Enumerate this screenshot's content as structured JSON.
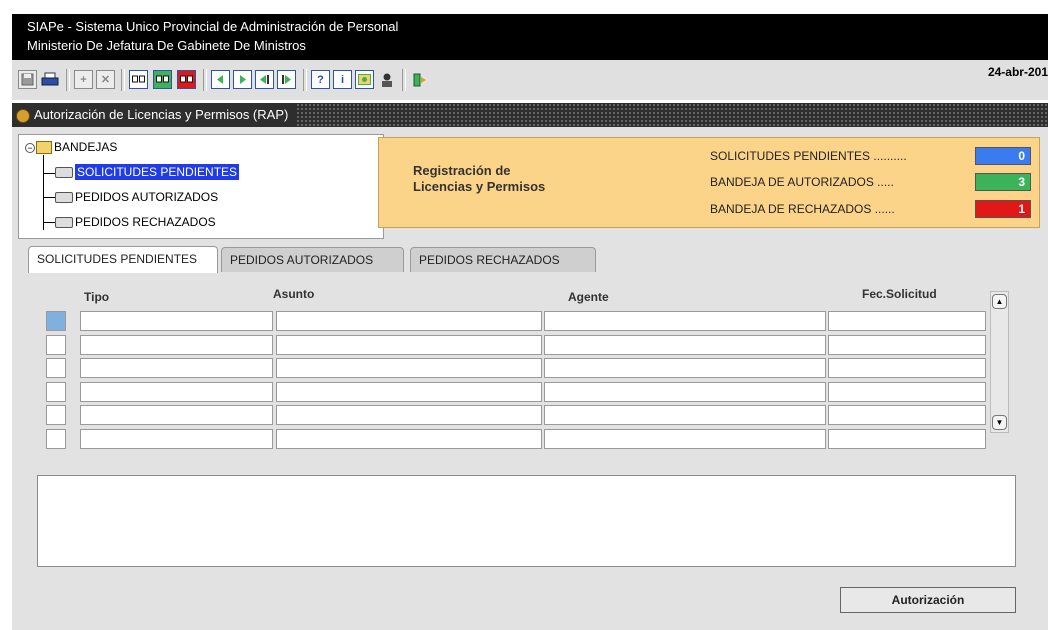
{
  "window": {
    "title_line1": "SIAPe - Sistema Unico Provincial de Administración de Personal",
    "title_line2": "Ministerio De Jefatura De Gabinete De Ministros"
  },
  "toolbar": {
    "date": "24-abr-201",
    "buttons": [
      {
        "name": "save-icon",
        "glyph": ""
      },
      {
        "name": "print-icon",
        "glyph": ""
      },
      {
        "name": "add-record-icon",
        "glyph": "+"
      },
      {
        "name": "delete-record-icon",
        "glyph": "✕"
      },
      {
        "name": "query-blue-icon",
        "glyph": ""
      },
      {
        "name": "query-green-icon",
        "glyph": ""
      },
      {
        "name": "query-red-icon",
        "glyph": ""
      },
      {
        "name": "first-record-icon",
        "glyph": "◀"
      },
      {
        "name": "next-record-icon",
        "glyph": "▶"
      },
      {
        "name": "prev-block-icon",
        "glyph": "◀"
      },
      {
        "name": "next-block-icon",
        "glyph": "▶"
      },
      {
        "name": "help-icon",
        "glyph": "?"
      },
      {
        "name": "info-icon",
        "glyph": "i"
      },
      {
        "name": "calendar-icon",
        "glyph": ""
      },
      {
        "name": "user-icon",
        "glyph": ""
      },
      {
        "name": "exit-icon",
        "glyph": ""
      }
    ]
  },
  "panel": {
    "title": "Autorización de Licencias y Permisos (RAP)"
  },
  "tree": {
    "root": "BANDEJAS",
    "items": [
      {
        "label": "SOLICITUDES PENDIENTES"
      },
      {
        "label": "PEDIDOS AUTORIZADOS"
      },
      {
        "label": "PEDIDOS RECHAZADOS"
      }
    ]
  },
  "summary": {
    "heading_line1": "Registración de",
    "heading_line2": "Licencias y Permisos",
    "rows": [
      {
        "label": "SOLICITUDES PENDIENTES ..........",
        "count": "0",
        "color": "#3a7cf0"
      },
      {
        "label": "BANDEJA DE AUTORIZADOS .....",
        "count": "3",
        "color": "#3cb35a"
      },
      {
        "label": "BANDEJA DE RECHAZADOS ......",
        "count": "1",
        "color": "#e01818"
      }
    ]
  },
  "tabs": [
    {
      "label": "SOLICITUDES PENDIENTES"
    },
    {
      "label": "PEDIDOS AUTORIZADOS"
    },
    {
      "label": "PEDIDOS RECHAZADOS"
    }
  ],
  "grid": {
    "columns": [
      "Tipo",
      "Asunto",
      "Agente",
      "Fec.Solicitud"
    ]
  },
  "actions": {
    "authorize_label": "Autorización"
  }
}
